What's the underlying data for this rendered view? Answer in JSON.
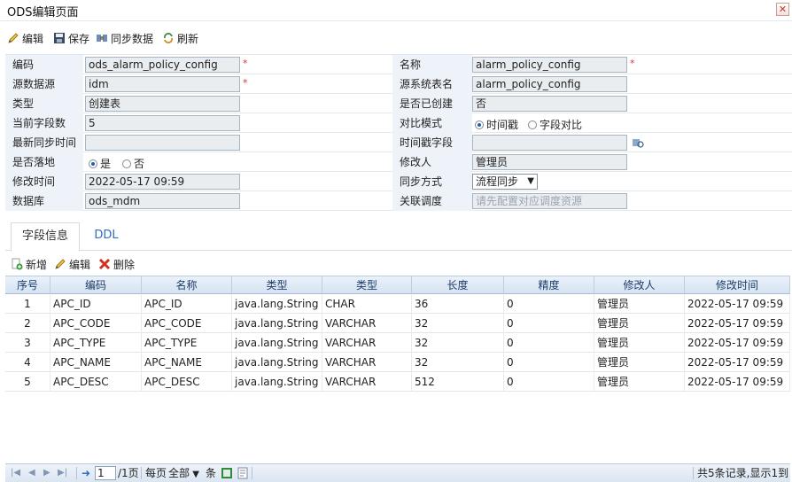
{
  "window": {
    "title": "ODS编辑页面",
    "close_label": "✕"
  },
  "toolbar": {
    "edit": "编辑",
    "save": "保存",
    "sync": "同步数据",
    "refresh": "刷新"
  },
  "form": {
    "code_label": "编码",
    "code_value": "ods_alarm_policy_config",
    "name_label": "名称",
    "name_value": "alarm_policy_config",
    "source_label": "源数据源",
    "source_value": "idm",
    "source_table_label": "源系统表名",
    "source_table_value": "alarm_policy_config",
    "type_label": "类型",
    "type_value": "创建表",
    "created_label": "是否已创建",
    "created_value": "否",
    "field_count_label": "当前字段数",
    "field_count_value": "5",
    "compare_label": "对比模式",
    "compare_opt1": "时间戳",
    "compare_opt2": "字段对比",
    "latest_sync_label": "最新同步时间",
    "latest_sync_value": "",
    "ts_field_label": "时间戳字段",
    "ts_field_value": "",
    "landing_label": "是否落地",
    "landing_yes": "是",
    "landing_no": "否",
    "modifier_label": "修改人",
    "modifier_value": "管理员",
    "modified_label": "修改时间",
    "modified_value": "2022-05-17 09:59",
    "sync_mode_label": "同步方式",
    "sync_mode_value": "流程同步",
    "db_label": "数据库",
    "db_value": "ods_mdm",
    "schedule_label": "关联调度",
    "schedule_placeholder": "请先配置对应调度资源",
    "required_mark": "*"
  },
  "tabs": [
    {
      "label": "字段信息"
    },
    {
      "label": "DDL"
    }
  ],
  "grid_toolbar": {
    "add": "新增",
    "edit": "编辑",
    "delete": "删除"
  },
  "table": {
    "headers": [
      "序号",
      "编码",
      "名称",
      "类型",
      "类型",
      "长度",
      "精度",
      "修改人",
      "修改时间"
    ],
    "rows": [
      [
        "1",
        "APC_ID",
        "APC_ID",
        "java.lang.String",
        "CHAR",
        "36",
        "0",
        "管理员",
        "2022-05-17 09:59"
      ],
      [
        "2",
        "APC_CODE",
        "APC_CODE",
        "java.lang.String",
        "VARCHAR",
        "32",
        "0",
        "管理员",
        "2022-05-17 09:59"
      ],
      [
        "3",
        "APC_TYPE",
        "APC_TYPE",
        "java.lang.String",
        "VARCHAR",
        "32",
        "0",
        "管理员",
        "2022-05-17 09:59"
      ],
      [
        "4",
        "APC_NAME",
        "APC_NAME",
        "java.lang.String",
        "VARCHAR",
        "32",
        "0",
        "管理员",
        "2022-05-17 09:59"
      ],
      [
        "5",
        "APC_DESC",
        "APC_DESC",
        "java.lang.String",
        "VARCHAR",
        "512",
        "0",
        "管理员",
        "2022-05-17 09:59"
      ]
    ]
  },
  "pager": {
    "page_value": "1",
    "total_pages": "/1页",
    "per_page_label": "每页",
    "per_page_value": "全部",
    "unit": "条",
    "summary": "共5条记录,显示1到5"
  },
  "colors": {
    "label_bg": "#eef3f9",
    "header_text": "#1c3d6a",
    "link": "#2b6cc4",
    "required": "#e03030"
  },
  "icons": [
    "pencil-icon",
    "floppy-icon",
    "sync-icon",
    "refresh-icon",
    "add-icon",
    "delete-icon",
    "close-icon",
    "lookup-icon"
  ]
}
